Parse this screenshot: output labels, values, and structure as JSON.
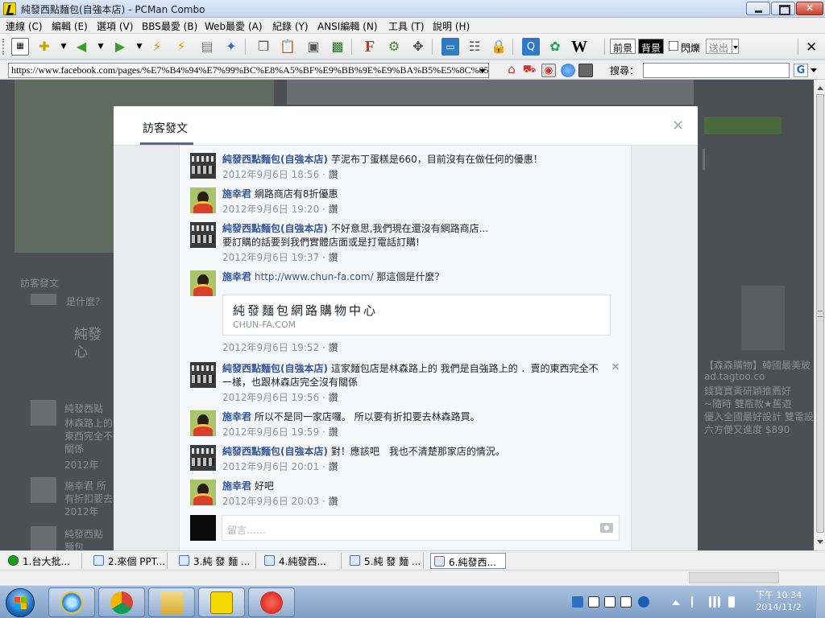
{
  "window": {
    "title": "純發西點麵包(自強本店) - PCMan Combo"
  },
  "menu": [
    "連線 (C)",
    "編輯 (E)",
    "選項 (V)",
    "BBS最愛 (B)",
    "Web最愛 (A)",
    "紀錄 (Y)",
    "ANSI編輯 (N)",
    "工具 (T)",
    "說明 (H)"
  ],
  "toolbar": {
    "fg_label": "前景",
    "bg_label": "背景",
    "blink_label": "閃爍",
    "send_label": "送出"
  },
  "address": {
    "url": "https://www.facebook.com/pages/%E7%B4%94%E7%99%BC%E8%A5%BF%E9%BB%9E%E9%BA%B5%E5%8C%85%",
    "search_label": "搜尋："
  },
  "background_page": {
    "snippets": [
      "訪客發文",
      "是什麼？",
      "純發",
      "心",
      "純發西點",
      "林森路上的",
      "東西完全不",
      "關係",
      "2012年",
      "施幸君 所",
      "有折扣要去",
      "2012年",
      "純發西點",
      "麵包",
      "【森森購物】韓國最美玻",
      "ad.tagtoo.co",
      "錢寶寶黃研穎推薦好",
      "~隨時 雙瓶款★舊遊",
      "優入全國最好設計 雙電設",
      "六方便又進度 $890"
    ]
  },
  "modal": {
    "title": "訪客發文",
    "close_label": "×",
    "compose_placeholder": "留言……",
    "comments": [
      {
        "author": "純發西點麵包(自強本店)",
        "text": "芋泥布丁蛋糕是660，目前沒有在做任何的優惠！",
        "time": "2012年9月6日 18:56",
        "like": "讚",
        "avatar": "shop"
      },
      {
        "author": "施幸君",
        "text": "網路商店有8折優惠",
        "time": "2012年9月6日 19:20",
        "like": "讚",
        "avatar": "person"
      },
      {
        "author": "純發西點麵包(自強本店)",
        "text": "不好意思,我們現在還沒有網路商店...",
        "text2": "要訂購的話要到我們實體店面或是打電話訂購!",
        "time": "2012年9月6日 19:37",
        "like": "讚",
        "avatar": "shop"
      },
      {
        "author": "施幸君",
        "link": "http://www.chun-fa.com/",
        "text": "那這個是什麼？",
        "time": "2012年9月6日 19:52",
        "like": "讚",
        "avatar": "person",
        "preview_title": "純發麵包網路購物中心",
        "preview_domain": "CHUN-FA.COM"
      },
      {
        "author": "純發西點麵包(自強本店)",
        "text": "這家麵包店是林森路上的 我們是自強路上的 ．賣的東西完全不一樣，也跟林森店完全沒有關係",
        "time": "2012年9月6日 19:56",
        "like": "讚",
        "avatar": "shop",
        "remove": "×"
      },
      {
        "author": "施幸君",
        "text": "所以不是同一家店囉。 所以要有折扣要去林森路買。",
        "time": "2012年9月6日 19:59",
        "like": "讚",
        "avatar": "person"
      },
      {
        "author": "純發西點麵包(自強本店)",
        "text": "對！應該吧　我也不清楚那家店的情況。",
        "time": "2012年9月6日 20:01",
        "like": "讚",
        "avatar": "shop"
      },
      {
        "author": "施幸君",
        "text": "好吧",
        "time": "2012年9月6日 20:03",
        "like": "讚",
        "avatar": "person"
      }
    ]
  },
  "tabs": [
    {
      "label": "1.台大批...",
      "icon": "green-globe-icon"
    },
    {
      "label": "2.來個 PPT...",
      "icon": "page-icon"
    },
    {
      "label": "3.純 發 麵 ...",
      "icon": "page-icon"
    },
    {
      "label": "4.純發西...",
      "icon": "page-icon"
    },
    {
      "label": "5.純 發 麵 ...",
      "icon": "page-icon"
    },
    {
      "label": "6.純發西...",
      "icon": "page-icon",
      "active": true
    }
  ],
  "taskbar": {
    "clock_time": "下午 10:34",
    "clock_date": "2014/11/2"
  }
}
